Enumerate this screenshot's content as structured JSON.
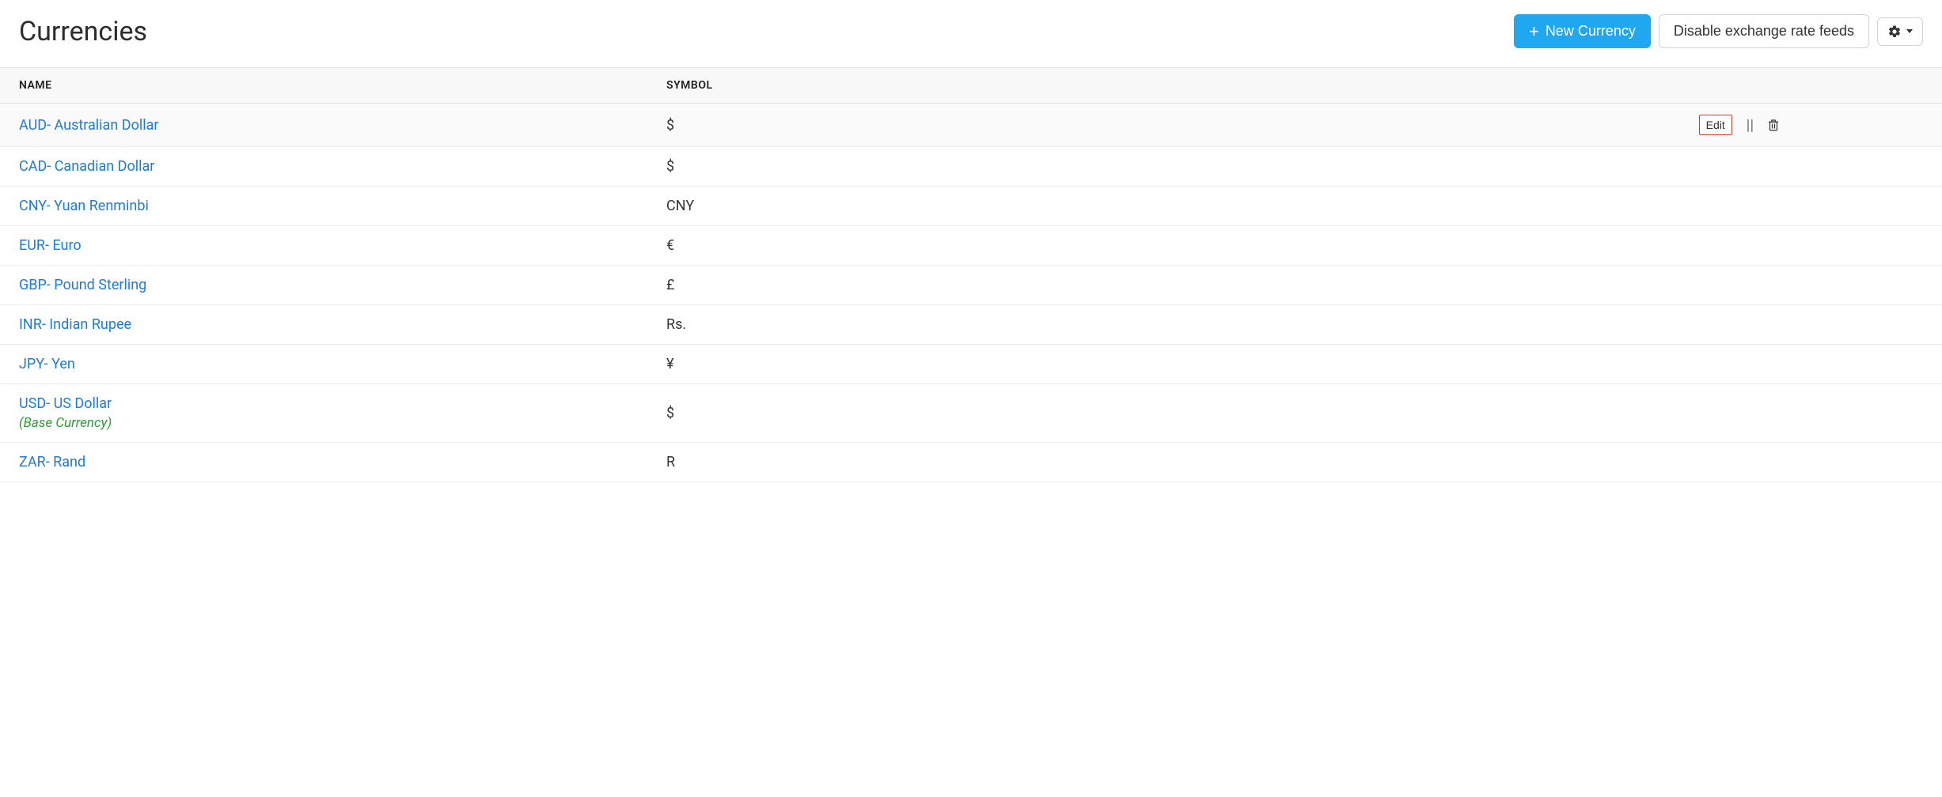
{
  "header": {
    "title": "Currencies",
    "new_button": "New Currency",
    "disable_button": "Disable exchange rate feeds"
  },
  "table": {
    "headers": {
      "name": "NAME",
      "symbol": "SYMBOL"
    },
    "edit_label": "Edit",
    "base_currency_label": "(Base Currency)"
  },
  "currencies": [
    {
      "name": "AUD- Australian Dollar",
      "symbol": "$",
      "hovered": true,
      "base": false
    },
    {
      "name": "CAD- Canadian Dollar",
      "symbol": "$",
      "hovered": false,
      "base": false
    },
    {
      "name": "CNY- Yuan Renminbi",
      "symbol": "CNY",
      "hovered": false,
      "base": false
    },
    {
      "name": "EUR- Euro",
      "symbol": "€",
      "hovered": false,
      "base": false
    },
    {
      "name": "GBP- Pound Sterling",
      "symbol": "£",
      "hovered": false,
      "base": false
    },
    {
      "name": "INR- Indian Rupee",
      "symbol": "Rs.",
      "hovered": false,
      "base": false
    },
    {
      "name": "JPY- Yen",
      "symbol": "¥",
      "hovered": false,
      "base": false
    },
    {
      "name": "USD- US Dollar",
      "symbol": "$",
      "hovered": false,
      "base": true
    },
    {
      "name": "ZAR- Rand",
      "symbol": "R",
      "hovered": false,
      "base": false
    }
  ]
}
